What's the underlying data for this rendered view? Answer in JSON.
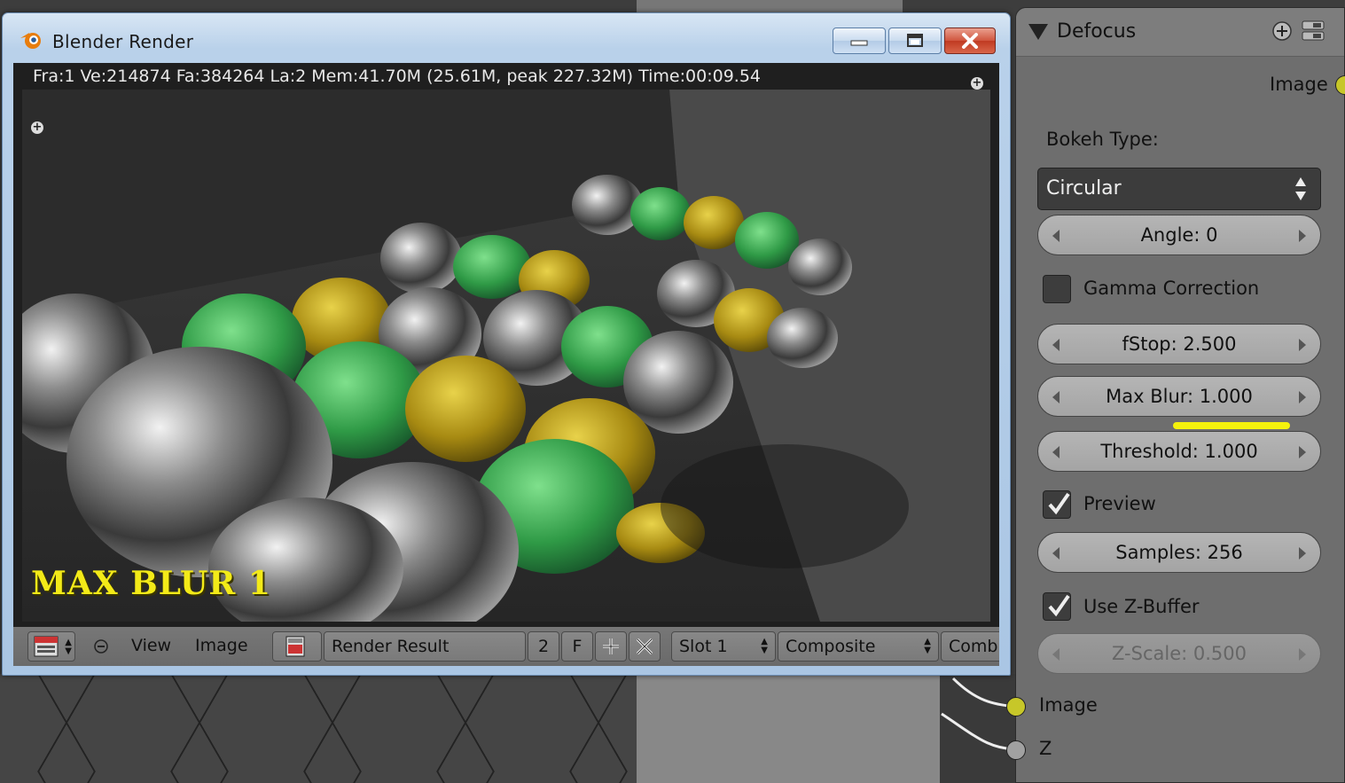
{
  "window": {
    "title": "Blender Render",
    "stats": "Fra:1  Ve:214874 Fa:384264 La:2 Mem:41.70M (25.61M, peak 227.32M) Time:00:09.54",
    "overlay_text": "MAX BLUR 1"
  },
  "image_header": {
    "menu_view": "View",
    "menu_image": "Image",
    "image_name": "Render Result",
    "users_count": "2",
    "fake_user": "F",
    "slot": "Slot 1",
    "layer": "Composite",
    "pass": "Combi"
  },
  "node": {
    "title": "Defocus",
    "output_image": "Image",
    "bokeh_type_label": "Bokeh Type:",
    "bokeh_type_value": "Circular",
    "angle": "Angle: 0",
    "gamma_correction": {
      "label": "Gamma Correction",
      "checked": false
    },
    "fstop": "fStop: 2.500",
    "max_blur": "Max Blur: 1.000",
    "threshold": "Threshold: 1.000",
    "preview": {
      "label": "Preview",
      "checked": true
    },
    "samples": "Samples: 256",
    "use_zbuffer": {
      "label": "Use Z-Buffer",
      "checked": true
    },
    "zscale": "Z-Scale: 0.500",
    "input_image": "Image",
    "input_z": "Z"
  },
  "colors": {
    "highlight": "#f4f20c",
    "image_socket": "#c7c729",
    "value_socket": "#a1a1a1",
    "overlay_text": "#f3ea18"
  }
}
